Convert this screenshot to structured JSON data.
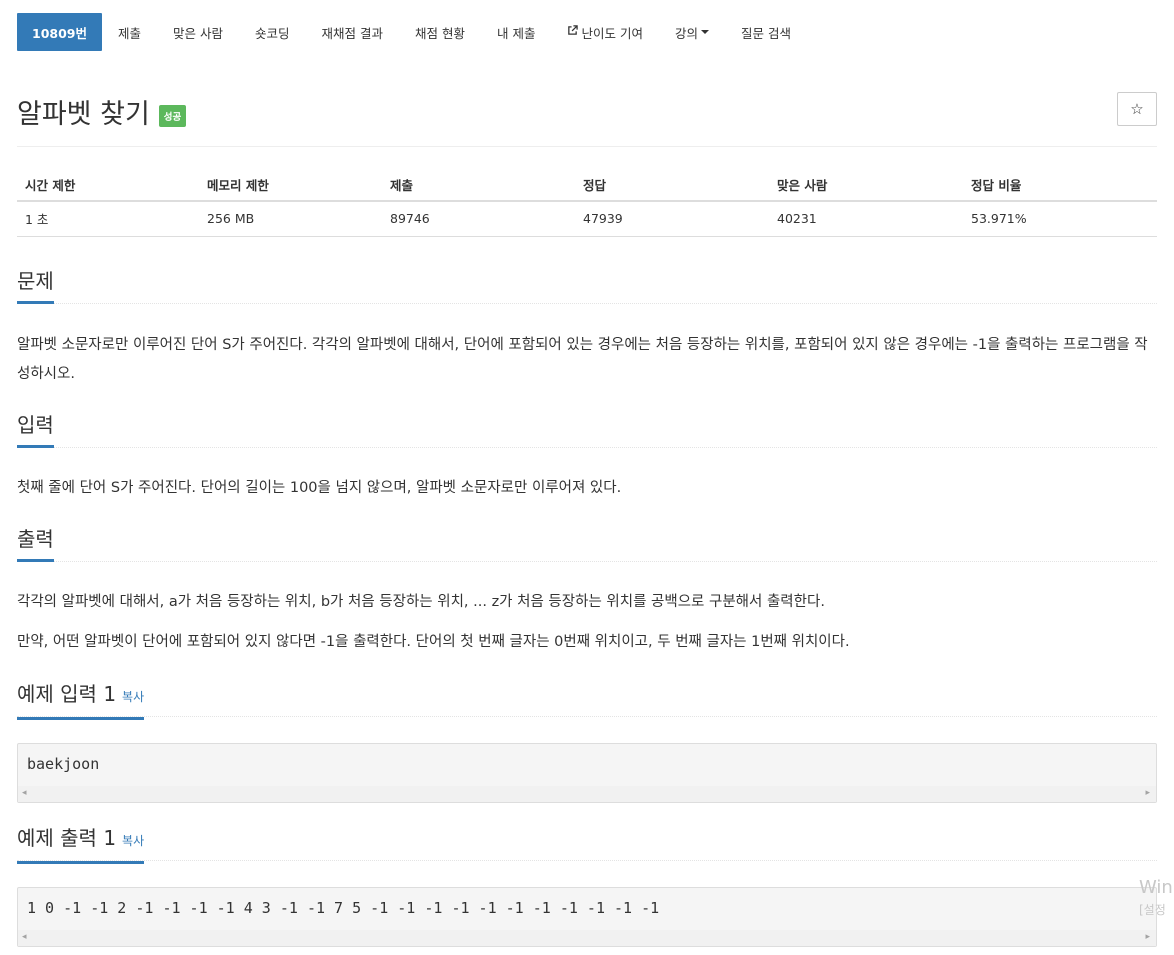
{
  "nav": {
    "items": [
      {
        "label": "10809번"
      },
      {
        "label": "제출"
      },
      {
        "label": "맞은 사람"
      },
      {
        "label": "숏코딩"
      },
      {
        "label": "재채점 결과"
      },
      {
        "label": "채점 현황"
      },
      {
        "label": "내 제출"
      },
      {
        "label": "난이도 기여",
        "icon": "external-link-icon"
      },
      {
        "label": "강의",
        "icon": "caret-down-icon"
      },
      {
        "label": "질문 검색"
      }
    ]
  },
  "problem": {
    "title": "알파벳 찾기",
    "badge": "성공",
    "star_glyph": "☆"
  },
  "info_table": {
    "headers": [
      "시간 제한",
      "메모리 제한",
      "제출",
      "정답",
      "맞은 사람",
      "정답 비율"
    ],
    "values": [
      "1 초",
      "256 MB",
      "89746",
      "47939",
      "40231",
      "53.971%"
    ]
  },
  "sections": {
    "problem": {
      "heading": "문제",
      "text": "알파벳 소문자로만 이루어진 단어 S가 주어진다. 각각의 알파벳에 대해서, 단어에 포함되어 있는 경우에는 처음 등장하는 위치를, 포함되어 있지 않은 경우에는 -1을 출력하는 프로그램을 작성하시오."
    },
    "input": {
      "heading": "입력",
      "text": "첫째 줄에 단어 S가 주어진다. 단어의 길이는 100을 넘지 않으며, 알파벳 소문자로만 이루어져 있다."
    },
    "output": {
      "heading": "출력",
      "text1": "각각의 알파벳에 대해서, a가 처음 등장하는 위치, b가 처음 등장하는 위치, ... z가 처음 등장하는 위치를 공백으로 구분해서 출력한다.",
      "text2": "만약, 어떤 알파벳이 단어에 포함되어 있지 않다면 -1을 출력한다. 단어의 첫 번째 글자는 0번째 위치이고, 두 번째 글자는 1번째 위치이다."
    },
    "sample_input": {
      "heading": "예제 입력 1",
      "copy_label": "복사",
      "code": "baekjoon"
    },
    "sample_output": {
      "heading": "예제 출력 1",
      "copy_label": "복사",
      "code": "1 0 -1 -1 2 -1 -1 -1 -1 4 3 -1 -1 7 5 -1 -1 -1 -1 -1 -1 -1 -1 -1 -1 -1"
    }
  },
  "scroll": {
    "left_glyph": "◂",
    "right_glyph": "▸"
  },
  "watermark": {
    "line1": "Win",
    "line2": "[설정"
  },
  "colors": {
    "primary": "#337ab7",
    "success": "#5cb85c"
  }
}
